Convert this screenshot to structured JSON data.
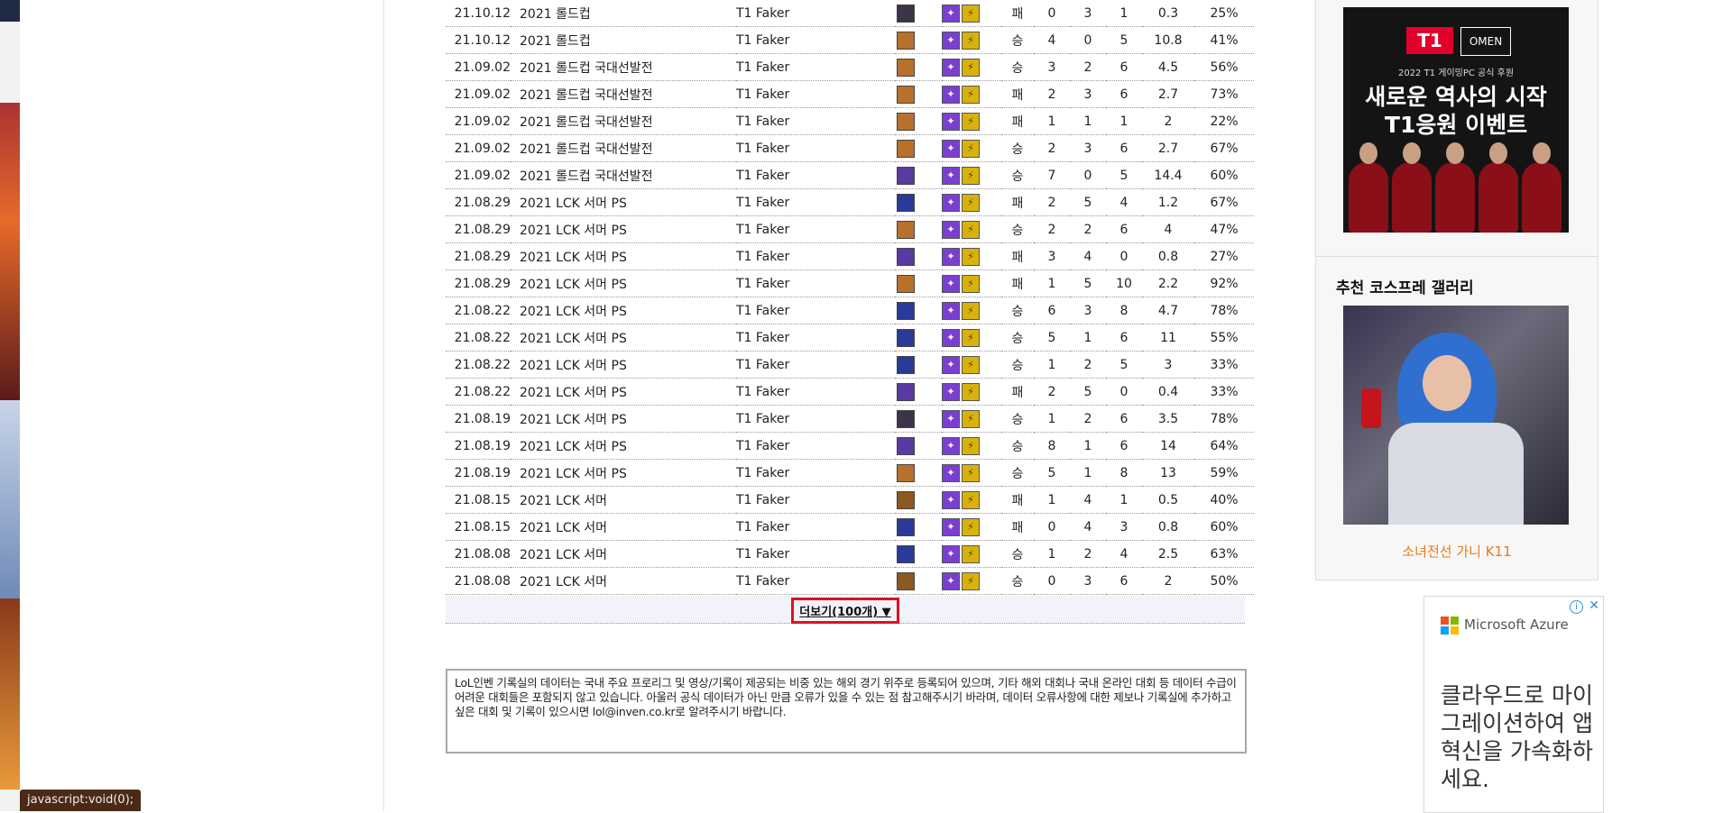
{
  "records": [
    {
      "date": "21.10.12",
      "event": "2021 롤드컵",
      "team": "T1 Faker",
      "result": "패",
      "k": "0",
      "d": "3",
      "a": "1",
      "kda": "0.3",
      "kp": "25%",
      "champ_color": "#3b3348"
    },
    {
      "date": "21.10.12",
      "event": "2021 롤드컵",
      "team": "T1 Faker",
      "result": "승",
      "k": "4",
      "d": "0",
      "a": "5",
      "kda": "10.8",
      "kp": "41%",
      "champ_color": "#b8702a"
    },
    {
      "date": "21.09.02",
      "event": "2021 롤드컵 국대선발전",
      "team": "T1 Faker",
      "result": "승",
      "k": "3",
      "d": "2",
      "a": "6",
      "kda": "4.5",
      "kp": "56%",
      "champ_color": "#b8702a"
    },
    {
      "date": "21.09.02",
      "event": "2021 롤드컵 국대선발전",
      "team": "T1 Faker",
      "result": "패",
      "k": "2",
      "d": "3",
      "a": "6",
      "kda": "2.7",
      "kp": "73%",
      "champ_color": "#b8702a"
    },
    {
      "date": "21.09.02",
      "event": "2021 롤드컵 국대선발전",
      "team": "T1 Faker",
      "result": "패",
      "k": "1",
      "d": "1",
      "a": "1",
      "kda": "2",
      "kp": "22%",
      "champ_color": "#b8702a"
    },
    {
      "date": "21.09.02",
      "event": "2021 롤드컵 국대선발전",
      "team": "T1 Faker",
      "result": "승",
      "k": "2",
      "d": "3",
      "a": "6",
      "kda": "2.7",
      "kp": "67%",
      "champ_color": "#b8702a"
    },
    {
      "date": "21.09.02",
      "event": "2021 롤드컵 국대선발전",
      "team": "T1 Faker",
      "result": "승",
      "k": "7",
      "d": "0",
      "a": "5",
      "kda": "14.4",
      "kp": "60%",
      "champ_color": "#5a3aa0"
    },
    {
      "date": "21.08.29",
      "event": "2021 LCK 서머 PS",
      "team": "T1 Faker",
      "result": "패",
      "k": "2",
      "d": "5",
      "a": "4",
      "kda": "1.2",
      "kp": "67%",
      "champ_color": "#2a3a9a"
    },
    {
      "date": "21.08.29",
      "event": "2021 LCK 서머 PS",
      "team": "T1 Faker",
      "result": "승",
      "k": "2",
      "d": "2",
      "a": "6",
      "kda": "4",
      "kp": "47%",
      "champ_color": "#b8702a"
    },
    {
      "date": "21.08.29",
      "event": "2021 LCK 서머 PS",
      "team": "T1 Faker",
      "result": "패",
      "k": "3",
      "d": "4",
      "a": "0",
      "kda": "0.8",
      "kp": "27%",
      "champ_color": "#5a3aa0"
    },
    {
      "date": "21.08.29",
      "event": "2021 LCK 서머 PS",
      "team": "T1 Faker",
      "result": "패",
      "k": "1",
      "d": "5",
      "a": "10",
      "kda": "2.2",
      "kp": "92%",
      "champ_color": "#b8702a"
    },
    {
      "date": "21.08.22",
      "event": "2021 LCK 서머 PS",
      "team": "T1 Faker",
      "result": "승",
      "k": "6",
      "d": "3",
      "a": "8",
      "kda": "4.7",
      "kp": "78%",
      "champ_color": "#2a3a9a"
    },
    {
      "date": "21.08.22",
      "event": "2021 LCK 서머 PS",
      "team": "T1 Faker",
      "result": "승",
      "k": "5",
      "d": "1",
      "a": "6",
      "kda": "11",
      "kp": "55%",
      "champ_color": "#2a3a9a"
    },
    {
      "date": "21.08.22",
      "event": "2021 LCK 서머 PS",
      "team": "T1 Faker",
      "result": "승",
      "k": "1",
      "d": "2",
      "a": "5",
      "kda": "3",
      "kp": "33%",
      "champ_color": "#2a3a9a"
    },
    {
      "date": "21.08.22",
      "event": "2021 LCK 서머 PS",
      "team": "T1 Faker",
      "result": "패",
      "k": "2",
      "d": "5",
      "a": "0",
      "kda": "0.4",
      "kp": "33%",
      "champ_color": "#5a3aa0"
    },
    {
      "date": "21.08.19",
      "event": "2021 LCK 서머 PS",
      "team": "T1 Faker",
      "result": "승",
      "k": "1",
      "d": "2",
      "a": "6",
      "kda": "3.5",
      "kp": "78%",
      "champ_color": "#3b3348"
    },
    {
      "date": "21.08.19",
      "event": "2021 LCK 서머 PS",
      "team": "T1 Faker",
      "result": "승",
      "k": "8",
      "d": "1",
      "a": "6",
      "kda": "14",
      "kp": "64%",
      "champ_color": "#5a3aa0"
    },
    {
      "date": "21.08.19",
      "event": "2021 LCK 서머 PS",
      "team": "T1 Faker",
      "result": "승",
      "k": "5",
      "d": "1",
      "a": "8",
      "kda": "13",
      "kp": "59%",
      "champ_color": "#b8702a"
    },
    {
      "date": "21.08.15",
      "event": "2021 LCK 서머",
      "team": "T1 Faker",
      "result": "패",
      "k": "1",
      "d": "4",
      "a": "1",
      "kda": "0.5",
      "kp": "40%",
      "champ_color": "#8a5a20"
    },
    {
      "date": "21.08.15",
      "event": "2021 LCK 서머",
      "team": "T1 Faker",
      "result": "패",
      "k": "0",
      "d": "4",
      "a": "3",
      "kda": "0.8",
      "kp": "60%",
      "champ_color": "#2a3a9a"
    },
    {
      "date": "21.08.08",
      "event": "2021 LCK 서머",
      "team": "T1 Faker",
      "result": "승",
      "k": "1",
      "d": "2",
      "a": "4",
      "kda": "2.5",
      "kp": "63%",
      "champ_color": "#2a3a9a"
    },
    {
      "date": "21.08.08",
      "event": "2021 LCK 서머",
      "team": "T1 Faker",
      "result": "승",
      "k": "0",
      "d": "3",
      "a": "6",
      "kda": "2",
      "kp": "50%",
      "champ_color": "#8a5a20"
    }
  ],
  "spells": {
    "flash_color": "#7a3fd1",
    "ignite_color": "#d8b20c"
  },
  "more_button": {
    "label": "더보기(100개) ▼"
  },
  "notice": {
    "text": "LoL인벤 기록실의 데이터는 국내 주요 프로리그 및 영상/기록이 제공되는 비중 있는 해외 경기 위주로 등록되어 있으며, 기타 해외 대회나 국내 온라인 대회 등 데이터 수급이 어려운 대회들은 포함되지 않고 있습니다. 아울러 공식 데이터가 아닌 만큼 오류가 있을 수 있는 점 참고해주시기 바라며, 데이터 오류사항에 대한 제보나 기록실에 추가하고 싶은 대회 및 기록이 있으시면 lol@inven.co.kr로 알려주시기 바랍니다."
  },
  "sidebar": {
    "banner1": {
      "logo": "T1",
      "partner": "OMEN",
      "subtitle": "2022 T1 게이밍PC 공식 후원",
      "title": "새로운 역사의 시작\nT1응원 이벤트"
    },
    "cosplay_title": "추천 코스프레 갤러리",
    "cosplay_caption": "소녀전선 가니 K11"
  },
  "ad": {
    "brand": "Microsoft Azure",
    "text": "클라우드로 마이그레이션하여 앱 혁신을 가속화하세요.",
    "info_icon": "info-icon",
    "close_icon": "close-icon"
  },
  "statusbar": {
    "text": "javascript:void(0);"
  }
}
